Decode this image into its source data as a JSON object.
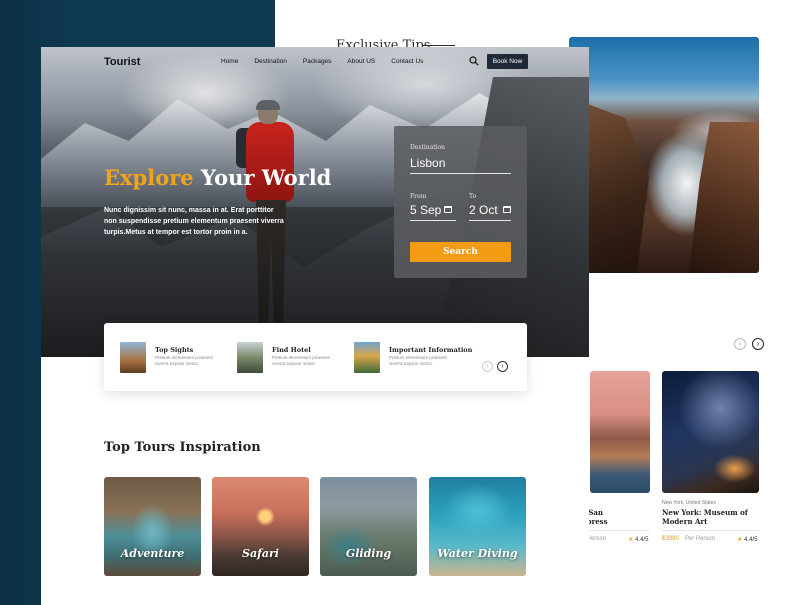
{
  "back_page": {
    "section_title": "Exclusive Tips",
    "cards": [
      {
        "meta": "",
        "title": "to San\nexpress",
        "price": "",
        "per": "Person",
        "rating": "4.4/5"
      },
      {
        "meta": "New York, United States",
        "title": "New York: Museum of\nModern Art",
        "price": "$3990",
        "per": "Per Person",
        "rating": "4.4/5"
      }
    ],
    "arrows": {
      "prev": "‹",
      "next": "›"
    }
  },
  "nav": {
    "logo": "Tourist",
    "items": [
      "Home",
      "Destination",
      "Packages",
      "About US",
      "Contact Us"
    ],
    "book_label": "Book Now"
  },
  "hero": {
    "headline_accent": "Explore",
    "headline_rest": " Your World",
    "text": "Nunc dignissim sit nunc, massa in at. Erat porttitor non suspendisse pretium elementum praesent viverra turpis.Metus at tempor est tortor proin in a."
  },
  "booking": {
    "destination_label": "Destination",
    "destination_value": "Lisbon",
    "from_label": "From",
    "from_value": "5 Sep",
    "to_label": "To",
    "to_value": "2 Oct",
    "search_label": "Search"
  },
  "info_bar": {
    "items": [
      {
        "title": "Top Sights",
        "desc": "Pretium elementum praesent viverra turpisin metus."
      },
      {
        "title": "Find Hotel",
        "desc": "Pretium elementum praesent viverra turpisin metus."
      },
      {
        "title": "Important Information",
        "desc": "Pretium elementum praesent viverra turpisin metus."
      }
    ],
    "prev": "‹",
    "next": "›"
  },
  "tours": {
    "title": "Top Tours Inspiration",
    "items": [
      {
        "label": "Adventure"
      },
      {
        "label": "Safari"
      },
      {
        "label": "Gliding"
      },
      {
        "label": "Water Diving"
      }
    ]
  },
  "colors": {
    "accent": "#f39c12",
    "dark": "#1f2937",
    "navy": "#0f3a52"
  }
}
